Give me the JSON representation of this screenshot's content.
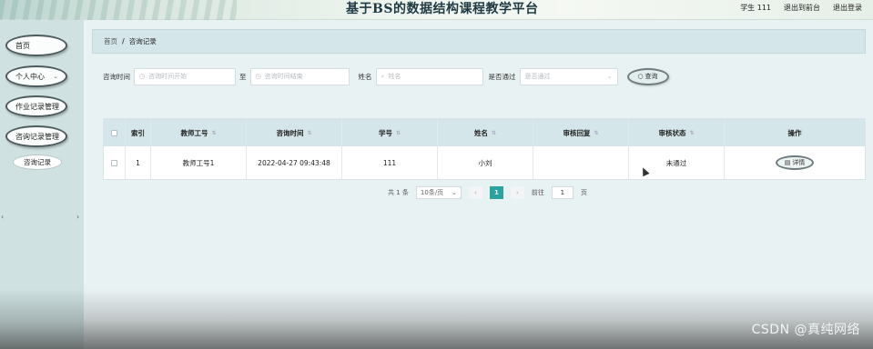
{
  "header": {
    "title": "基于BS的数据结构课程教学平台",
    "user": "学生 111",
    "back_to_front": "退出到前台",
    "logout": "退出登录"
  },
  "sidebar": {
    "items": [
      {
        "label": "首页"
      },
      {
        "label": "个人中心"
      },
      {
        "label": "作业记录管理"
      },
      {
        "label": "咨询记录管理"
      }
    ],
    "sub_item": "咨询记录"
  },
  "breadcrumb": {
    "home": "首页",
    "separator": "/",
    "current": "咨询记录"
  },
  "search": {
    "time_label": "咨询时间",
    "start_placeholder": "咨询时间开始",
    "to_label": "至",
    "end_placeholder": "咨询时间结束",
    "name_label": "姓名",
    "name_placeholder": "姓名",
    "passed_label": "是否通过",
    "passed_placeholder": "是否通过",
    "button": "查询"
  },
  "table": {
    "headers": [
      "索引",
      "教师工号",
      "咨询时间",
      "学号",
      "姓名",
      "审核回复",
      "审核状态",
      "操作"
    ],
    "rows": [
      {
        "index": "1",
        "teacher_id": "教师工号1",
        "time": "2022-04-27 09:43:48",
        "student_id": "111",
        "name": "小刘",
        "reply": "",
        "status": "未通过",
        "action": "详情"
      }
    ]
  },
  "pagination": {
    "total": "共 1 条",
    "page_size": "10条/页",
    "current_page": "1",
    "goto_label": "前往",
    "goto_value": "1",
    "page_unit": "页"
  },
  "watermark": "CSDN @真纯网络",
  "colors": {
    "accent": "#2aa3a0",
    "sidebar_bg": "#cfe1e1",
    "table_header_bg": "#d5e6ea"
  }
}
